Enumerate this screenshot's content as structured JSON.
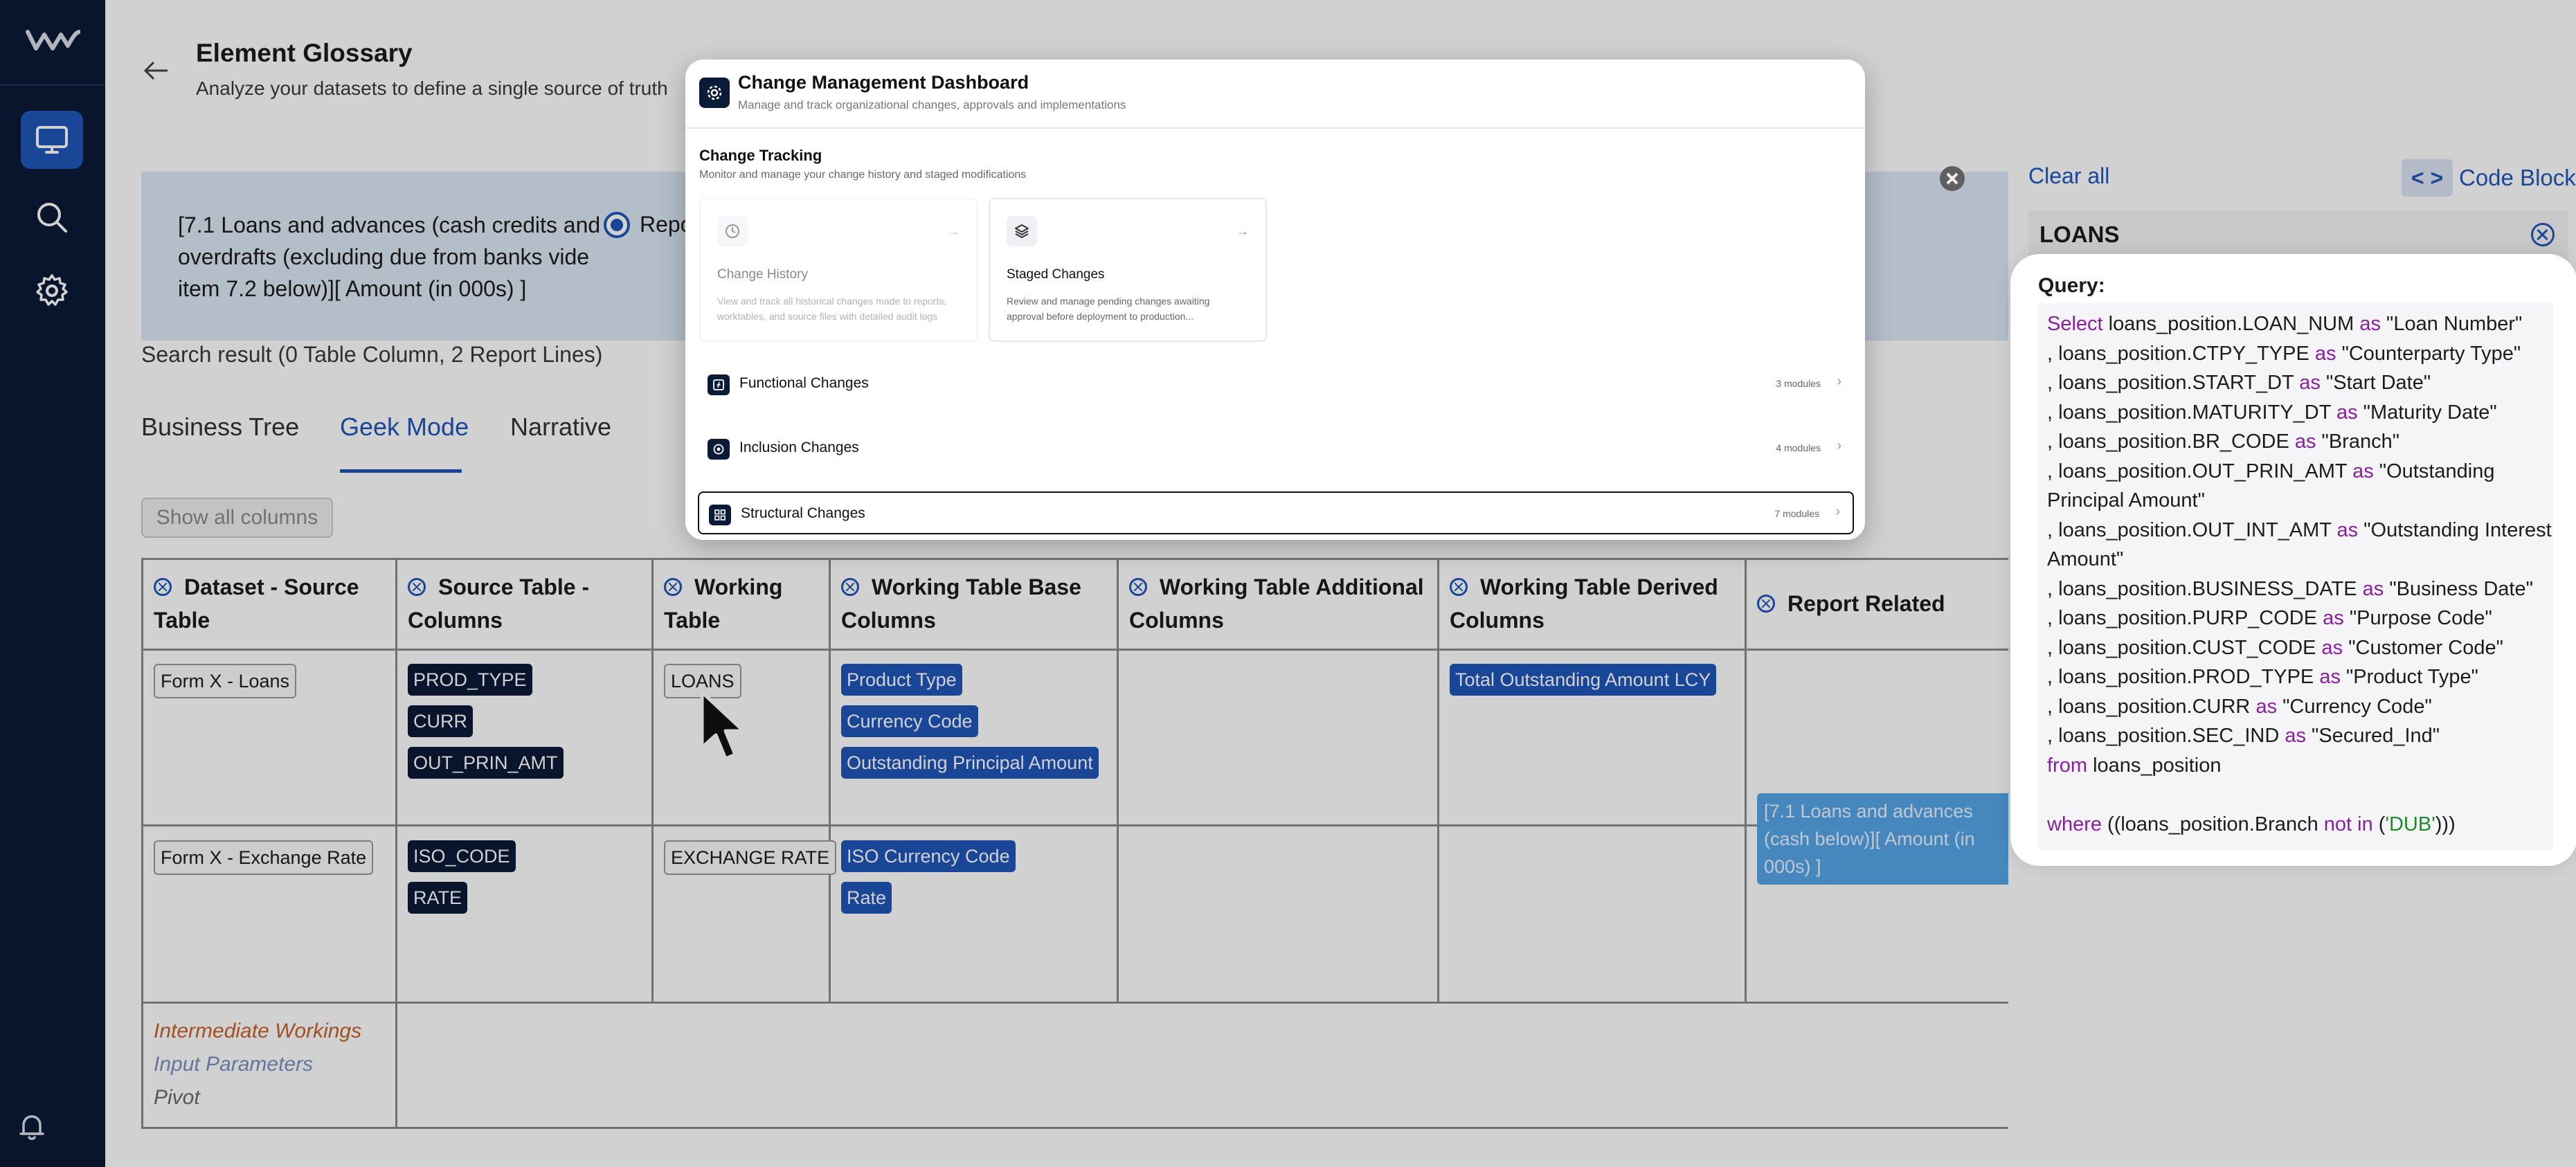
{
  "header": {
    "title": "Element Glossary",
    "subtitle": "Analyze your datasets to define a single source of truth"
  },
  "filter": {
    "text": "[7.1 Loans and advances (cash credits and overdrafts (excluding due from banks vide item 7.2 below)][ Amount (in 000s) ]",
    "radio_label": "Repo"
  },
  "search_result": "Search result (0 Table Column, 2 Report Lines)",
  "tabs": [
    "Business Tree",
    "Geek Mode",
    "Narrative"
  ],
  "show_all_columns": "Show all columns",
  "grid": {
    "headers": [
      "Dataset - Source Table",
      "Source Table - Columns",
      "Working Table",
      "Working Table Base Columns",
      "Working Table Additional Columns",
      "Working Table Derived Columns",
      "Report Related"
    ],
    "rows": [
      {
        "dataset": "Form X - Loans",
        "source_columns": [
          "PROD_TYPE",
          "CURR",
          "OUT_PRIN_AMT"
        ],
        "working_table": "LOANS",
        "base_columns": [
          "Product Type",
          "Currency Code",
          "Outstanding Principal Amount"
        ],
        "derived_columns": [
          "Total Outstanding Amount LCY"
        ]
      },
      {
        "dataset": "Form X - Exchange Rate",
        "source_columns": [
          "ISO_CODE",
          "RATE"
        ],
        "working_table": "EXCHANGE RATE",
        "base_columns": [
          "ISO Currency Code",
          "Rate"
        ],
        "derived_columns": []
      }
    ],
    "report_related": "[7.1 Loans and advances (cash below)][ Amount (in 000s) ]",
    "footer": [
      "Intermediate Workings",
      "Input Parameters",
      "Pivot"
    ]
  },
  "right_panel": {
    "clear_all": "Clear all",
    "code_toggle": "< >",
    "code_block": "Code Block",
    "selected": "LOANS",
    "query_label": "Query:",
    "query": {
      "select": "Select",
      "as": "as",
      "from": "from",
      "from_table": "loans_position",
      "where": "where",
      "not_in": "not in",
      "columns": [
        {
          "lead": "",
          "expr": "loans_position.LOAN_NUM",
          "alias": "\"Loan Number\""
        },
        {
          "lead": ", ",
          "expr": "loans_position.CTPY_TYPE",
          "alias": "\"Counterparty Type\""
        },
        {
          "lead": ", ",
          "expr": "loans_position.START_DT",
          "alias": "\"Start Date\""
        },
        {
          "lead": ", ",
          "expr": "loans_position.MATURITY_DT",
          "alias": "\"Maturity Date\""
        },
        {
          "lead": ", ",
          "expr": "loans_position.BR_CODE",
          "alias": "\"Branch\""
        },
        {
          "lead": ", ",
          "expr": "loans_position.OUT_PRIN_AMT",
          "alias": "\"Outstanding",
          "cont": "Principal Amount\""
        },
        {
          "lead": ", ",
          "expr": "loans_position.OUT_INT_AMT",
          "alias": "\"Outstanding Interest",
          "cont": "Amount\""
        },
        {
          "lead": ", ",
          "expr": "loans_position.BUSINESS_DATE",
          "alias": "\"Business Date\""
        },
        {
          "lead": ", ",
          "expr": "loans_position.PURP_CODE",
          "alias": "\"Purpose Code\""
        },
        {
          "lead": ", ",
          "expr": "loans_position.CUST_CODE",
          "alias": "\"Customer Code\""
        },
        {
          "lead": ", ",
          "expr": "loans_position.PROD_TYPE",
          "alias": "\"Product Type\""
        },
        {
          "lead": ", ",
          "expr": "loans_position.CURR",
          "alias": "\"Currency Code\""
        },
        {
          "lead": ", ",
          "expr": "loans_position.SEC_IND",
          "alias": "\"Secured_Ind\""
        }
      ],
      "where_prefix": "((loans_position.Branch",
      "where_value": "('DUB'",
      "where_suffix": ")))"
    }
  },
  "change_management": {
    "title": "Change Management Dashboard",
    "subtitle": "Manage and track organizational changes, approvals and implementations",
    "section_title": "Change Tracking",
    "section_subtitle": "Monitor and manage your change history and staged modifications",
    "cards": [
      {
        "title": "Change History",
        "desc": "View and track all historical changes made to reports, worktables, and source files with detailed audit logs"
      },
      {
        "title": "Staged Changes",
        "desc": "Review and manage pending changes awaiting approval before deployment to production..."
      }
    ],
    "rows": [
      {
        "title": "Functional Changes",
        "count": "3 modules"
      },
      {
        "title": "Inclusion Changes",
        "count": "4 modules"
      },
      {
        "title": "Structural Changes",
        "count": "7 modules"
      }
    ]
  },
  "colors": {
    "sidebar": "#0b1a36",
    "accent": "#1f56b8",
    "keyword": "#8a1f9e",
    "string": "#1f8a2a"
  }
}
